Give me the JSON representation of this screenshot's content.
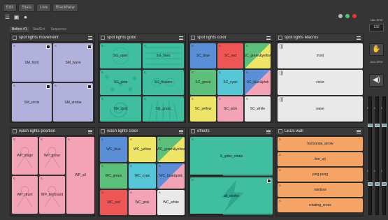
{
  "topbar": [
    {
      "name": "tb-edit",
      "label": "Edit"
    },
    {
      "name": "tb-stats",
      "label": "Stats"
    },
    {
      "name": "tb-mode",
      "label": "Live"
    },
    {
      "name": "tb-blackout",
      "label": "BlackNew"
    }
  ],
  "tabs": [
    "Before #1",
    "Stat/Ent",
    "Sequence"
  ],
  "colors": {
    "purple": "#b2b1dc",
    "teal": "#3fbf9f",
    "pink": "#f4a3b6",
    "green": "#5cc07a",
    "yellow": "#eee466",
    "gray": "#e9e9e9",
    "orange": "#f5a466",
    "blue": "#5a8fd8",
    "red": "#ee5555",
    "cyan": "#55c6d5",
    "bluepink": "#c8a6d8"
  },
  "panels": {
    "p1": {
      "title": "spot lights movement",
      "buttons": [
        "SM_front",
        "SM_wave",
        "SM_circle",
        "SM_strobe"
      ]
    },
    "p2": {
      "title": "spot lights gobo",
      "buttons": [
        "SG_open",
        "SG_lines",
        "SG_dots",
        "SG_flowers",
        "SG_swirl",
        "SG_grass"
      ]
    },
    "p3": {
      "title": "spot lights color",
      "buttons": [
        "SC_blue",
        "SC_red",
        "SC_green&yellow",
        "SC_green",
        "SC_cyan",
        "SC_blue&pink",
        "SC_yellow",
        "SC_pink",
        "SC_white"
      ]
    },
    "p4": {
      "title": "spot lights Macros",
      "buttons": [
        "front",
        "circle",
        "wave"
      ]
    },
    "p5": {
      "title": "wash lights position",
      "buttons": [
        "WP_stage",
        "WP_guitar",
        "WP_drum",
        "WP_keyboard",
        "WP_all"
      ]
    },
    "p6": {
      "title": "wash lights color",
      "buttons": [
        "WC_blue",
        "WC_yellow",
        "WC_green&yellow",
        "WC_green",
        "WC_cyan",
        "WC_blue&pink",
        "WC_red",
        "WC_pink",
        "WC_white"
      ]
    },
    "p7": {
      "title": "effects",
      "buttons": [
        "S_gobo_rotate",
        "all_strobe"
      ]
    },
    "p8": {
      "title": "LEDs wall",
      "buttons": [
        "horizontal_arrow",
        "line_up",
        "ping-pong",
        "rainbow",
        "rotating_cross"
      ]
    }
  },
  "right": {
    "bpm_label": "Man BPM",
    "bpm_value": "132",
    "auto_label": "Auto BPM",
    "fader_labels": [
      "0%",
      "0%",
      "0%",
      "0%",
      "0%",
      "0%"
    ]
  }
}
